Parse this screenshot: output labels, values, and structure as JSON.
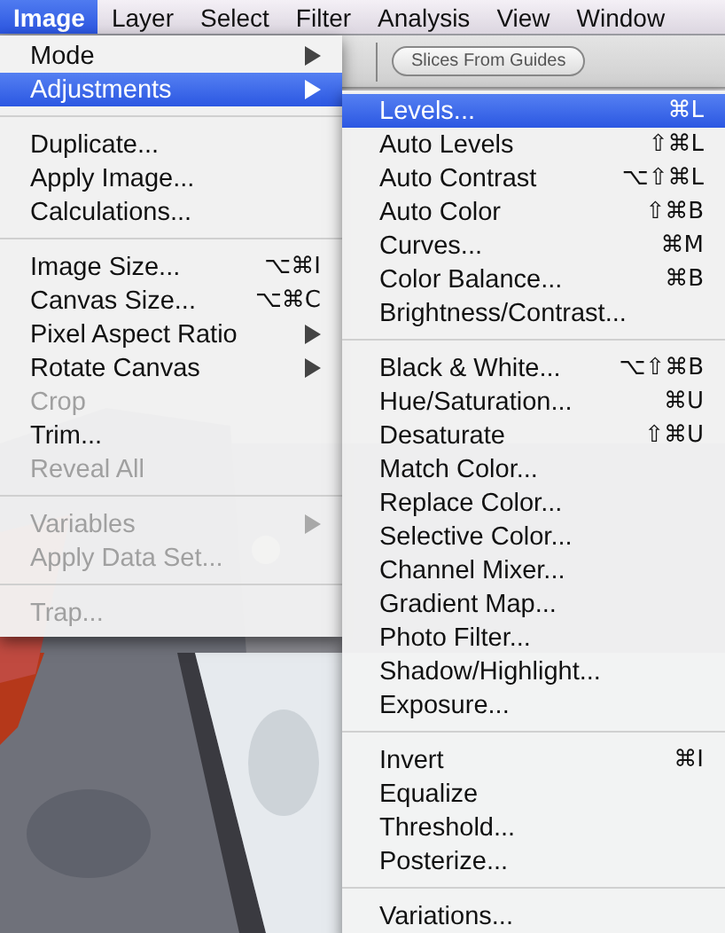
{
  "menubar": [
    {
      "label": "Image",
      "selected": true
    },
    {
      "label": "Layer",
      "selected": false
    },
    {
      "label": "Select",
      "selected": false
    },
    {
      "label": "Filter",
      "selected": false
    },
    {
      "label": "Analysis",
      "selected": false
    },
    {
      "label": "View",
      "selected": false
    },
    {
      "label": "Window",
      "selected": false
    }
  ],
  "toolbar": {
    "button": "Slices From Guides"
  },
  "image_menu": {
    "groups": [
      [
        {
          "label": "Mode",
          "submenu": true,
          "disabled": false,
          "selected": false
        },
        {
          "label": "Adjustments",
          "submenu": true,
          "disabled": false,
          "selected": true
        }
      ],
      [
        {
          "label": "Duplicate...",
          "submenu": false,
          "disabled": false,
          "selected": false
        },
        {
          "label": "Apply Image...",
          "submenu": false,
          "disabled": false,
          "selected": false
        },
        {
          "label": "Calculations...",
          "submenu": false,
          "disabled": false,
          "selected": false
        }
      ],
      [
        {
          "label": "Image Size...",
          "shortcut": "⌥⌘I",
          "submenu": false,
          "disabled": false,
          "selected": false
        },
        {
          "label": "Canvas Size...",
          "shortcut": "⌥⌘C",
          "submenu": false,
          "disabled": false,
          "selected": false
        },
        {
          "label": "Pixel Aspect Ratio",
          "submenu": true,
          "disabled": false,
          "selected": false
        },
        {
          "label": "Rotate Canvas",
          "submenu": true,
          "disabled": false,
          "selected": false
        },
        {
          "label": "Crop",
          "submenu": false,
          "disabled": true,
          "selected": false
        },
        {
          "label": "Trim...",
          "submenu": false,
          "disabled": false,
          "selected": false
        },
        {
          "label": "Reveal All",
          "submenu": false,
          "disabled": true,
          "selected": false
        }
      ],
      [
        {
          "label": "Variables",
          "submenu": true,
          "disabled": true,
          "selected": false
        },
        {
          "label": "Apply Data Set...",
          "submenu": false,
          "disabled": true,
          "selected": false
        }
      ],
      [
        {
          "label": "Trap...",
          "submenu": false,
          "disabled": true,
          "selected": false
        }
      ]
    ]
  },
  "adjustments_menu": {
    "groups": [
      [
        {
          "label": "Levels...",
          "shortcut": "⌘L",
          "submenu": false,
          "disabled": false,
          "selected": true
        },
        {
          "label": "Auto Levels",
          "shortcut": "⇧⌘L",
          "submenu": false,
          "disabled": false,
          "selected": false
        },
        {
          "label": "Auto Contrast",
          "shortcut": "⌥⇧⌘L",
          "submenu": false,
          "disabled": false,
          "selected": false
        },
        {
          "label": "Auto Color",
          "shortcut": "⇧⌘B",
          "submenu": false,
          "disabled": false,
          "selected": false
        },
        {
          "label": "Curves...",
          "shortcut": "⌘M",
          "submenu": false,
          "disabled": false,
          "selected": false
        },
        {
          "label": "Color Balance...",
          "shortcut": "⌘B",
          "submenu": false,
          "disabled": false,
          "selected": false
        },
        {
          "label": "Brightness/Contrast...",
          "submenu": false,
          "disabled": false,
          "selected": false
        }
      ],
      [
        {
          "label": "Black & White...",
          "shortcut": "⌥⇧⌘B",
          "submenu": false,
          "disabled": false,
          "selected": false
        },
        {
          "label": "Hue/Saturation...",
          "shortcut": "⌘U",
          "submenu": false,
          "disabled": false,
          "selected": false
        },
        {
          "label": "Desaturate",
          "shortcut": "⇧⌘U",
          "submenu": false,
          "disabled": false,
          "selected": false
        },
        {
          "label": "Match Color...",
          "submenu": false,
          "disabled": false,
          "selected": false
        },
        {
          "label": "Replace Color...",
          "submenu": false,
          "disabled": false,
          "selected": false
        },
        {
          "label": "Selective Color...",
          "submenu": false,
          "disabled": false,
          "selected": false
        },
        {
          "label": "Channel Mixer...",
          "submenu": false,
          "disabled": false,
          "selected": false
        },
        {
          "label": "Gradient Map...",
          "submenu": false,
          "disabled": false,
          "selected": false
        },
        {
          "label": "Photo Filter...",
          "submenu": false,
          "disabled": false,
          "selected": false
        },
        {
          "label": "Shadow/Highlight...",
          "submenu": false,
          "disabled": false,
          "selected": false
        },
        {
          "label": "Exposure...",
          "submenu": false,
          "disabled": false,
          "selected": false
        }
      ],
      [
        {
          "label": "Invert",
          "shortcut": "⌘I",
          "submenu": false,
          "disabled": false,
          "selected": false
        },
        {
          "label": "Equalize",
          "submenu": false,
          "disabled": false,
          "selected": false
        },
        {
          "label": "Threshold...",
          "submenu": false,
          "disabled": false,
          "selected": false
        },
        {
          "label": "Posterize...",
          "submenu": false,
          "disabled": false,
          "selected": false
        }
      ],
      [
        {
          "label": "Variations...",
          "submenu": false,
          "disabled": false,
          "selected": false
        }
      ]
    ]
  }
}
